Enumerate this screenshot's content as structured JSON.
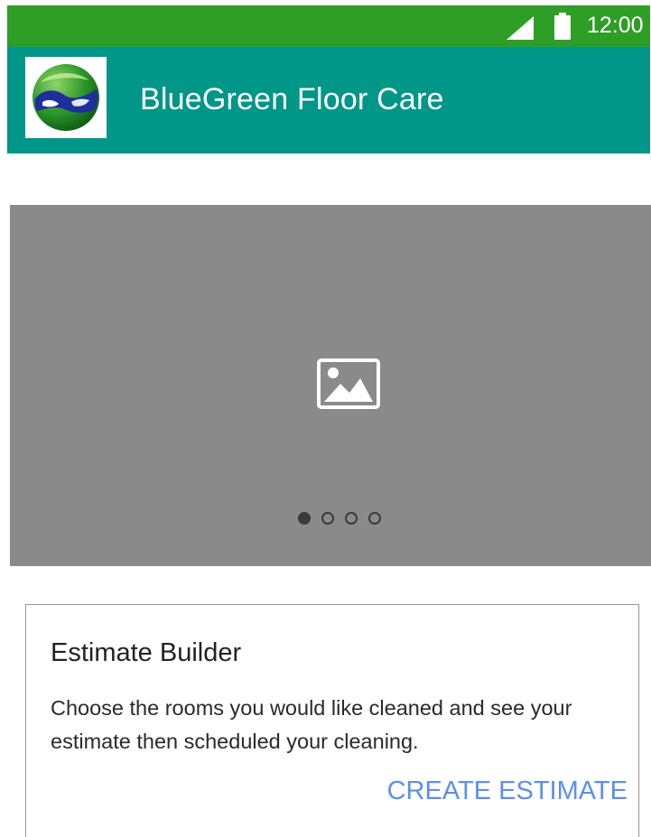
{
  "status_bar": {
    "time": "12:00",
    "signal_icon": "cell-signal-icon",
    "battery_icon": "battery-icon",
    "color": "#2e9e27"
  },
  "app_bar": {
    "title": "BlueGreen Floor Care",
    "logo_icon": "globe-logo-icon",
    "color": "#009688"
  },
  "carousel": {
    "placeholder_icon": "image-placeholder-icon",
    "page_count": 4,
    "active_page": 1,
    "color": "#8a8a8a"
  },
  "card": {
    "title": "Estimate Builder",
    "body": "Choose the rooms you would like cleaned and see your estimate then scheduled your cleaning.",
    "action_label": "CREATE ESTIMATE",
    "action_color": "#5b8ff0"
  }
}
